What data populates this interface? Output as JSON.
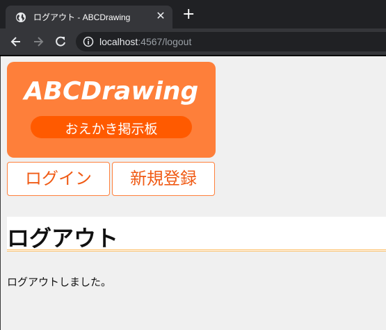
{
  "browser": {
    "tab_title": "ログアウト - ABCDrawing",
    "tab_close": "✕",
    "new_tab": "+",
    "url_host": "localhost",
    "url_port": ":4567/logout"
  },
  "logo": {
    "title": "ABCDrawing",
    "subtitle": "おえかき掲示板"
  },
  "nav": {
    "login_label": "ログイン",
    "register_label": "新規登録"
  },
  "main": {
    "heading": "ログアウト",
    "message": "ログアウトしました。"
  },
  "colors": {
    "brand_orange": "#fe7f3a",
    "pill_orange": "#ff5a00",
    "button_text": "#f05a14",
    "heading_underline": "#fdbf66"
  }
}
